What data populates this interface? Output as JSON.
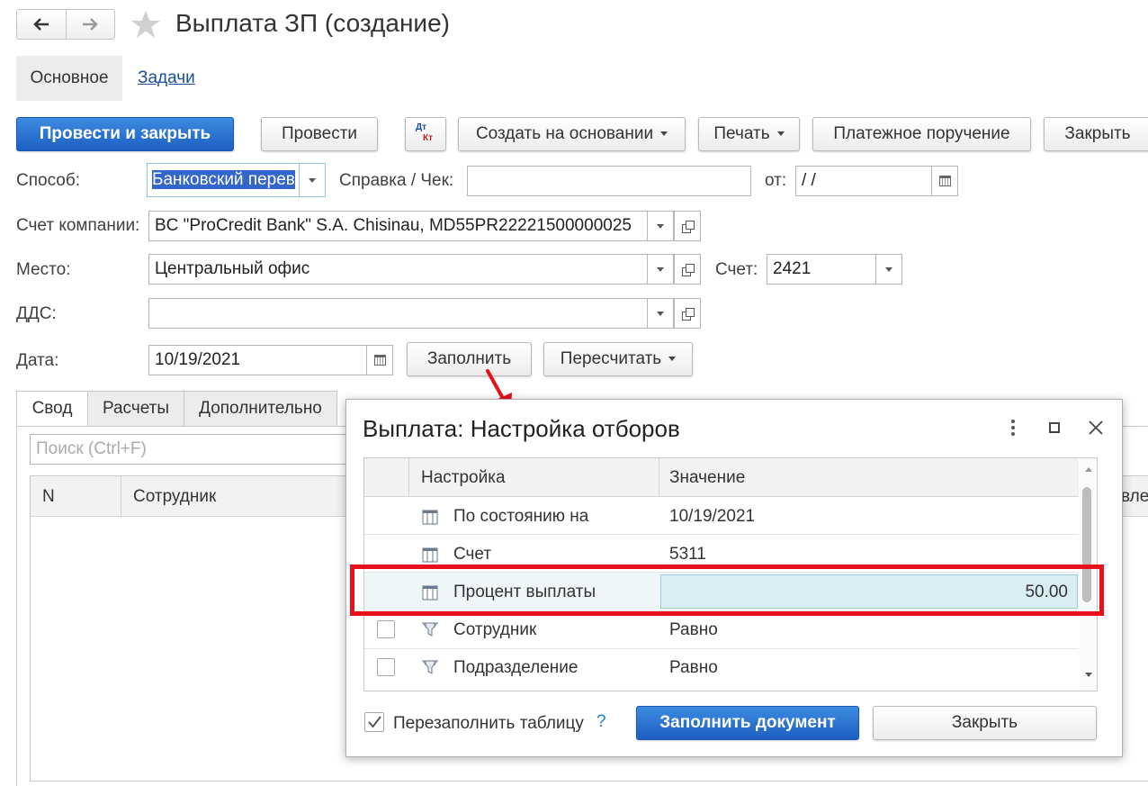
{
  "window": {
    "title": "Выплата ЗП (создание)"
  },
  "nav_tabs": {
    "main": "Основное",
    "tasks": "Задачи"
  },
  "toolbar": {
    "post_close": "Провести и закрыть",
    "post": "Провести",
    "dtkt_top": "Дт",
    "dtkt_bottom": "Кт",
    "create_based": "Создать на основании",
    "print": "Печать",
    "payment_order": "Платежное поручение",
    "close": "Закрыть"
  },
  "form": {
    "method_label": "Способ:",
    "method_value": "Банковский перев",
    "receipt_label": "Справка / Чек:",
    "receipt_value": "",
    "from_label": "от:",
    "from_value": " /  /",
    "company_account_label": "Счет компании:",
    "company_account_value": "BC \"ProCredit Bank\" S.A. Chisinau, MD55PR22221500000025",
    "place_label": "Место:",
    "place_value": "Центральный офис",
    "account_label": "Счет:",
    "account_value": "2421",
    "dds_label": "ДДС:",
    "dds_value": "",
    "date_label": "Дата:",
    "date_value": "10/19/2021",
    "fill_button": "Заполнить",
    "recalc_button": "Пересчитать"
  },
  "tabs": [
    "Свод",
    "Расчеты",
    "Дополнительно"
  ],
  "search": {
    "placeholder": "Поиск (Ctrl+F)"
  },
  "table": {
    "col_n": "N",
    "col_employee": "Сотрудник",
    "col_cut": "вле"
  },
  "dialog": {
    "title": "Выплата: Настройка отборов",
    "col_setting": "Настройка",
    "col_value": "Значение",
    "rows": [
      {
        "setting": "По состоянию на",
        "value": "10/19/2021",
        "has_checkbox": false,
        "icon": "parameter-icon"
      },
      {
        "setting": "Счет",
        "value": "5311",
        "has_checkbox": false,
        "icon": "parameter-icon"
      },
      {
        "setting": "Процент выплаты",
        "value": "50.00",
        "has_checkbox": false,
        "icon": "parameter-icon",
        "highlighted": true
      },
      {
        "setting": "Сотрудник",
        "value": "Равно",
        "has_checkbox": true,
        "icon": "filter-icon"
      },
      {
        "setting": "Подразделение",
        "value": "Равно",
        "has_checkbox": true,
        "icon": "filter-icon"
      }
    ],
    "refill_label": "Перезаполнить таблицу",
    "refill_checked": true,
    "help": "?",
    "fill_doc_button": "Заполнить документ",
    "close_button": "Закрыть"
  },
  "colors": {
    "primary": "#1d5fc2",
    "highlight_border": "#e8101a",
    "selected_cell": "#d8eef2",
    "arrow": "#e8101a"
  }
}
